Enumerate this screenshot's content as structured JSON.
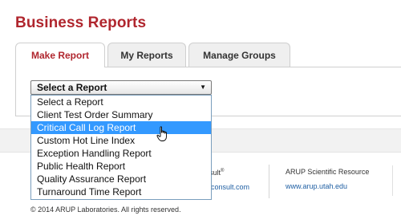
{
  "page": {
    "title": "Business Reports"
  },
  "tabs": [
    {
      "label": "Make Report",
      "active": true
    },
    {
      "label": "My Reports",
      "active": false
    },
    {
      "label": "Manage Groups",
      "active": false
    }
  ],
  "report_select": {
    "value": "Select a Report",
    "options": [
      "Select a Report",
      "Client Test Order Summary",
      "Critical Call Log Report",
      "Custom Hot Line Index",
      "Exception Handling Report",
      "Public Health Report",
      "Quality Assurance Report",
      "Turnaround Time Report"
    ],
    "highlighted": "Critical Call Log Report"
  },
  "footer": {
    "fragment_1": "sult",
    "fragment_1_mark": "®",
    "fragment_2": "consult.com",
    "resource_title": "ARUP Scientific Resource",
    "resource_link": "www.arup.utah.edu",
    "copyright": "© 2014 ARUP Laboratories. All rights reserved."
  },
  "colors": {
    "brand": "#b0262e",
    "highlight": "#3399ff",
    "link": "#1f5fa3"
  },
  "icons": {
    "dropdown_arrow": "triangle-down-icon",
    "cursor": "hand-pointer-icon"
  }
}
